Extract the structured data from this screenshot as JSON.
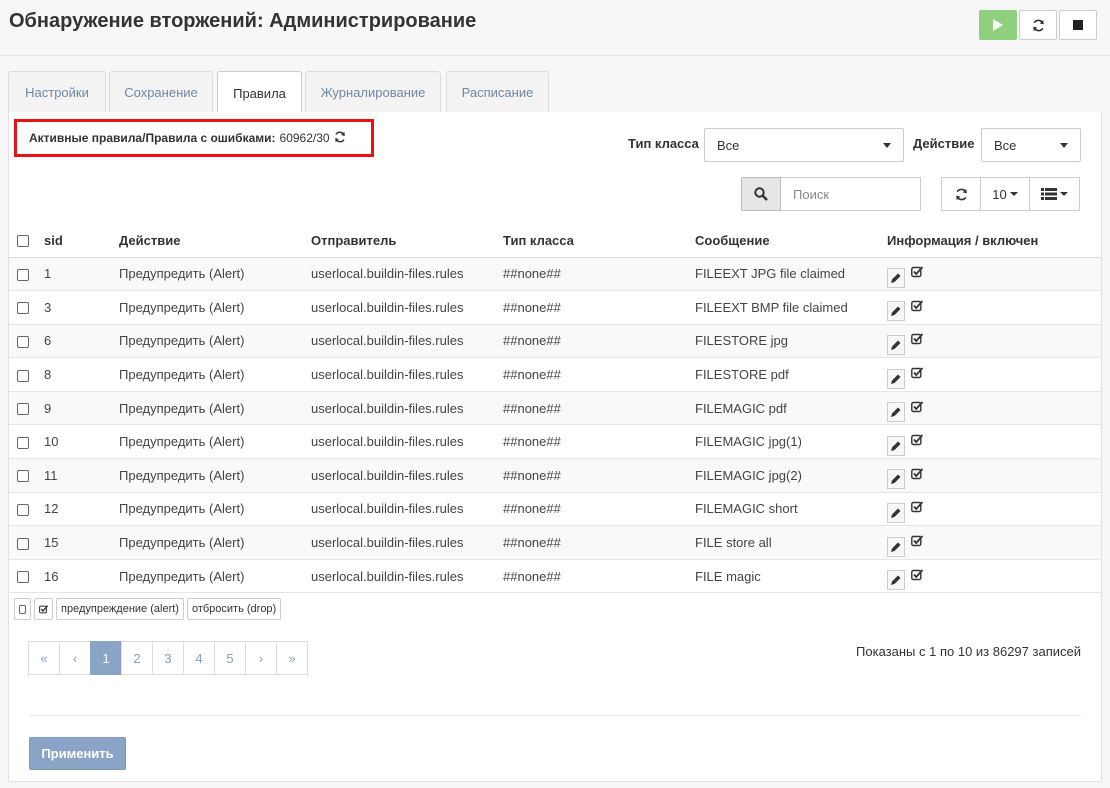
{
  "page": {
    "title": "Обнаружение вторжений: Администрирование"
  },
  "header_buttons": {
    "play_icon": "play-icon",
    "reload_icon": "reload-icon",
    "stop_icon": "stop-icon"
  },
  "tabs": [
    {
      "label": "Настройки",
      "active": false
    },
    {
      "label": "Сохранение",
      "active": false
    },
    {
      "label": "Правила",
      "active": true
    },
    {
      "label": "Журналирование",
      "active": false
    },
    {
      "label": "Расписание",
      "active": false
    }
  ],
  "active_rules": {
    "label": "Активные правила/Правила с ошибками:",
    "count": "60962/30"
  },
  "filters": {
    "class_type_label": "Тип класса",
    "class_type_value": "Все",
    "action_label": "Действие",
    "action_value": "Все"
  },
  "search": {
    "placeholder": "Поиск"
  },
  "toolbar": {
    "page_size": "10"
  },
  "columns": [
    "sid",
    "Действие",
    "Отправитель",
    "Тип класса",
    "Сообщение",
    "Информация / включен"
  ],
  "rows": [
    {
      "sid": "1",
      "action": "Предупредить (Alert)",
      "source": "userlocal.buildin-files.rules",
      "classtype": "##none##",
      "message": "FILEEXT JPG file claimed"
    },
    {
      "sid": "3",
      "action": "Предупредить (Alert)",
      "source": "userlocal.buildin-files.rules",
      "classtype": "##none##",
      "message": "FILEEXT BMP file claimed"
    },
    {
      "sid": "6",
      "action": "Предупредить (Alert)",
      "source": "userlocal.buildin-files.rules",
      "classtype": "##none##",
      "message": "FILESTORE jpg"
    },
    {
      "sid": "8",
      "action": "Предупредить (Alert)",
      "source": "userlocal.buildin-files.rules",
      "classtype": "##none##",
      "message": "FILESTORE pdf"
    },
    {
      "sid": "9",
      "action": "Предупредить (Alert)",
      "source": "userlocal.buildin-files.rules",
      "classtype": "##none##",
      "message": "FILEMAGIC pdf"
    },
    {
      "sid": "10",
      "action": "Предупредить (Alert)",
      "source": "userlocal.buildin-files.rules",
      "classtype": "##none##",
      "message": "FILEMAGIC jpg(1)"
    },
    {
      "sid": "11",
      "action": "Предупредить (Alert)",
      "source": "userlocal.buildin-files.rules",
      "classtype": "##none##",
      "message": "FILEMAGIC jpg(2)"
    },
    {
      "sid": "12",
      "action": "Предупредить (Alert)",
      "source": "userlocal.buildin-files.rules",
      "classtype": "##none##",
      "message": "FILEMAGIC short"
    },
    {
      "sid": "15",
      "action": "Предупредить (Alert)",
      "source": "userlocal.buildin-files.rules",
      "classtype": "##none##",
      "message": "FILE store all"
    },
    {
      "sid": "16",
      "action": "Предупредить (Alert)",
      "source": "userlocal.buildin-files.rules",
      "classtype": "##none##",
      "message": "FILE magic"
    }
  ],
  "bulk": {
    "alert_label": "предупреждение (alert)",
    "drop_label": "отбросить (drop)"
  },
  "pagination": {
    "first": "«",
    "prev": "‹",
    "pages": [
      "1",
      "2",
      "3",
      "4",
      "5"
    ],
    "next": "›",
    "last": "»",
    "current": "1",
    "info": "Показаны с 1 по 10 из 86297 записей"
  },
  "apply_label": "Применить",
  "colors": {
    "accent": "#8aa4c8",
    "play": "#8fd07e",
    "highlight_border": "#ee1111"
  }
}
